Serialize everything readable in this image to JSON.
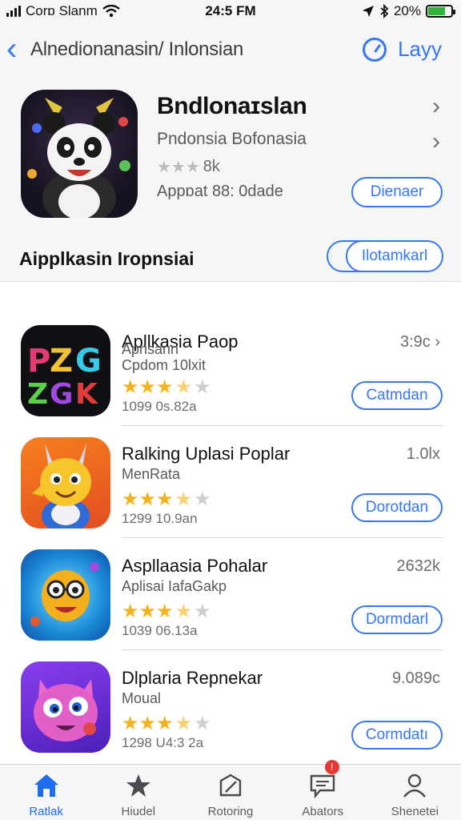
{
  "status_bar": {
    "carrier": "Corɒ Slanm",
    "time": "24:5 FM",
    "battery_text": "20%",
    "battery_level": 0.75
  },
  "nav": {
    "back_title": "Alnedionanasin/ Inlonsian",
    "action_label": "Layy"
  },
  "featured": {
    "name": "Bndlonaɪslan",
    "subtitle": "Pndonsia Bofonasia",
    "rating_count": "8k",
    "meta": "Appɒat 88: 0dade",
    "button_label": "Dienaer"
  },
  "section": {
    "title": "Aipplkasin Iropnsiai",
    "button_label": "Ilotamkarl"
  },
  "apps": [
    {
      "name": "Apllkasia Paop",
      "sub1": "Apnsann",
      "sub2": "Cpdom 10lxit",
      "rating": 3.5,
      "date": "1099 0s.82a",
      "size": "3:9c",
      "show_chevron": true,
      "button_label": "Catmdan"
    },
    {
      "name": "Ralking Uplasi Poplar",
      "sub1": "MenRata",
      "sub2": "",
      "rating": 3.5,
      "date": "1299 10.9an",
      "size": "1.0lx",
      "show_chevron": false,
      "button_label": "Dorotdan"
    },
    {
      "name": "Aspllaasia Pohalar",
      "sub1": "Aplisai IafaGakp",
      "sub2": "",
      "rating": 3.5,
      "date": "1039 06.13a",
      "size": "2632k",
      "show_chevron": false,
      "button_label": "Dormdarl"
    },
    {
      "name": "Dlplaria Repnekar",
      "sub1": "Moual",
      "sub2": "",
      "rating": 3.5,
      "date": "1298 U4:3 2a",
      "size": "9.089c",
      "show_chevron": false,
      "button_label": "Cormdatı"
    }
  ],
  "tabs": [
    {
      "label": "Ratlak",
      "icon": "home-icon",
      "active": true
    },
    {
      "label": "Hiudel",
      "icon": "star-icon",
      "active": false
    },
    {
      "label": "Rotoring",
      "icon": "square-pen-icon",
      "active": false
    },
    {
      "label": "Abators",
      "icon": "chat-icon",
      "active": false,
      "badge": "!"
    },
    {
      "label": "Shenetei",
      "icon": "person-icon",
      "active": false
    }
  ],
  "colors": {
    "accent": "#3478f6",
    "star": "#f4b31d",
    "battery": "#2fb33a",
    "badge": "#e53935"
  }
}
